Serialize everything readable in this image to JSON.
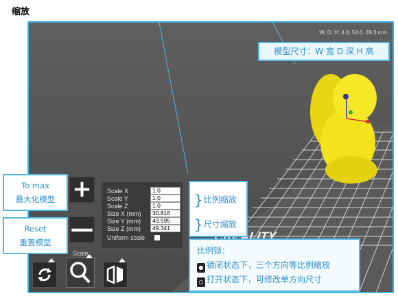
{
  "page_title": "缩放",
  "viewport": {
    "dims_text": "W, D, H: 4.8, 54.0, 49.3 mm",
    "brand": "CREALITY"
  },
  "callouts": {
    "model_size": "模型尺寸：W 宽  D 深  H 高",
    "to_max_en": "To max",
    "to_max_cn": "最大化模型",
    "reset_en": "Reset",
    "reset_cn": "重置模型",
    "proportional_scale": "比例缩放",
    "size_scale": "尺寸缩放",
    "lock_title": "比例锁：",
    "lock_closed": "锁闭状态下，三个方向等比例缩放",
    "lock_open": "打开状态下，可修改单方向尺寸"
  },
  "buttons": {
    "plus": "+",
    "minus": "—"
  },
  "scale_panel": {
    "rows": [
      {
        "label": "Scale X",
        "value": "1.0"
      },
      {
        "label": "Scale Y",
        "value": "1.0"
      },
      {
        "label": "Scale Z",
        "value": "1.0"
      },
      {
        "label": "Size X (mm)",
        "value": "30.816"
      },
      {
        "label": "Size Y (mm)",
        "value": "43.595"
      },
      {
        "label": "Size Z (mm)",
        "value": "49.341"
      }
    ],
    "uniform_label": "Uniform scale"
  },
  "toolbar": {
    "active_label": "Scale"
  },
  "colors": {
    "accent": "#3fb3e6",
    "model": "#f2e31c",
    "grid": "#e8e8e8"
  }
}
